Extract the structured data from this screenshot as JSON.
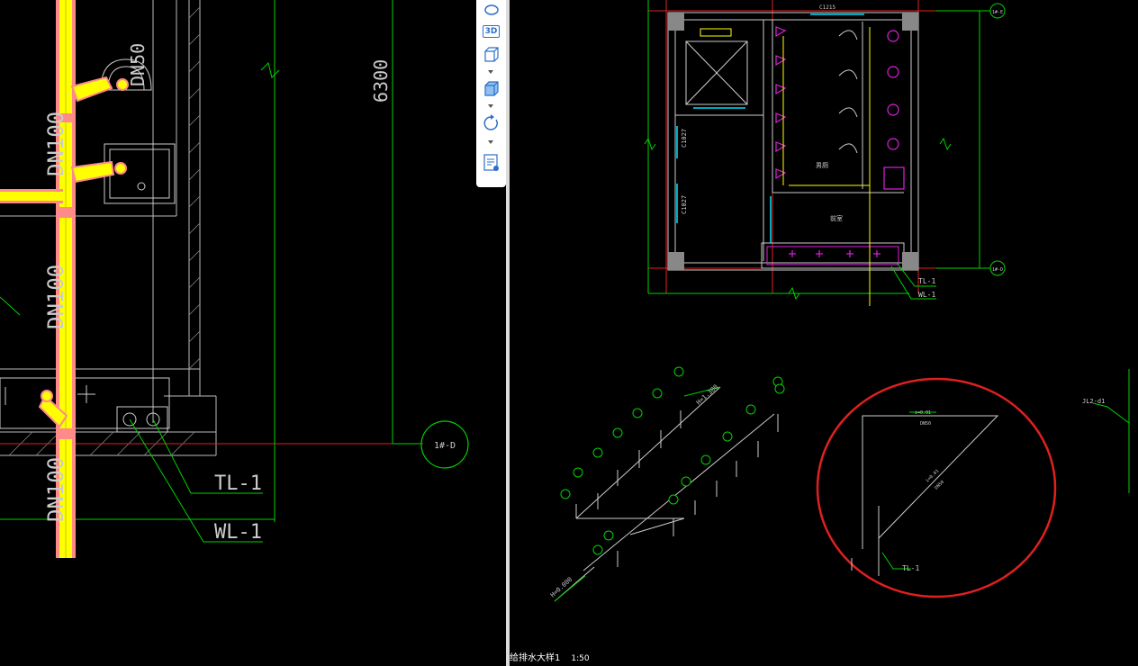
{
  "left_view": {
    "pipe_labels": [
      "DN100",
      "DN100",
      "DN100"
    ],
    "top_fragment": "DN50",
    "dimension": "6300",
    "axis_bubble": "1#-D",
    "leader_labels": [
      "TL-1",
      "WL-1"
    ]
  },
  "toolbar": {
    "items": [
      {
        "name": "orbit-icon",
        "label": ""
      },
      {
        "name": "view-3d-button",
        "label": "3D"
      },
      {
        "name": "view-cube-front-icon",
        "label": ""
      },
      {
        "name": "view-cube-shaded-icon",
        "label": ""
      },
      {
        "name": "rotate-icon",
        "label": ""
      },
      {
        "name": "properties-icon",
        "label": ""
      }
    ]
  },
  "right_view": {
    "axis_top": "1#-E",
    "axis_bottom": "1#-D",
    "room_labels": [
      "前室",
      "男厕",
      "女厕"
    ],
    "door_labels": [
      "C1215",
      "C1027",
      "C1027"
    ],
    "leader_labels": [
      "TL-1",
      "WL-1"
    ],
    "iso_elevations": [
      "H=1.300",
      "H=0.000"
    ],
    "circled_labels": [
      "DN50",
      "DN50",
      "TL-1",
      "i=0.01",
      "i=0.01"
    ],
    "side_label": "JL2-d1",
    "caption_title": "给排水大样1",
    "caption_scale": "1:50"
  },
  "colors": {
    "background": "#000000",
    "pipe_yellow": "#ffff00",
    "pipe_pink": "#ff8a8a",
    "cad_green": "#00d200",
    "wall_white": "#cccccc",
    "axis_red": "#e02020",
    "fixture_magenta": "#e020e0",
    "cyan": "#00e0ff",
    "highlight_circle": "#e02020"
  }
}
